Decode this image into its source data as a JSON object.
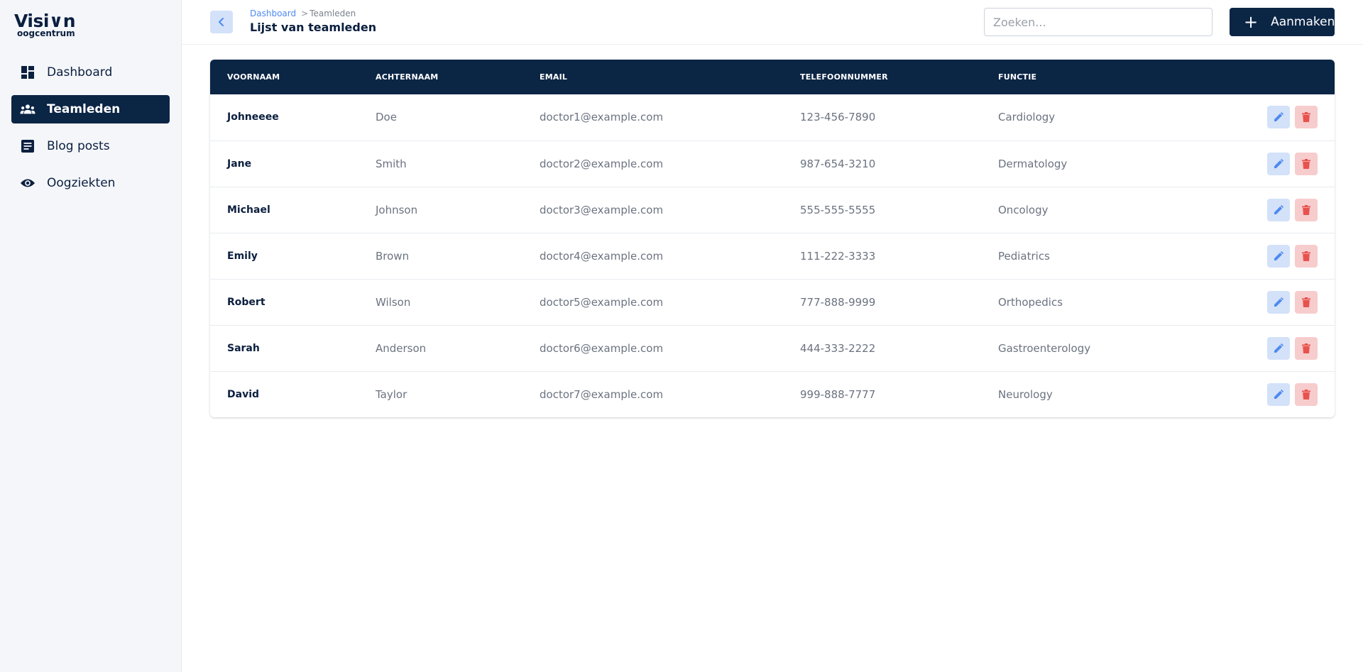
{
  "brand": {
    "name": "Visi∨n",
    "sub": "oogcentrum"
  },
  "nav": [
    {
      "label": "Dashboard",
      "icon": "dashboard-icon",
      "active": false
    },
    {
      "label": "Teamleden",
      "icon": "team-icon",
      "active": true
    },
    {
      "label": "Blog posts",
      "icon": "article-icon",
      "active": false
    },
    {
      "label": "Oogziekten",
      "icon": "eye-icon",
      "active": false
    }
  ],
  "header": {
    "breadcrumb": {
      "parent": "Dashboard",
      "separator": ">",
      "current": "Teamleden"
    },
    "title": "Lijst van teamleden",
    "search_placeholder": "Zoeken...",
    "search_value": "",
    "create_label": "Aanmaken"
  },
  "table": {
    "columns": [
      "VOORNAAM",
      "ACHTERNAAM",
      "EMAIL",
      "TELEFOONNUMMER",
      "FUNCTIE",
      ""
    ],
    "rows": [
      {
        "first": "Johneeee",
        "last": "Doe",
        "email": "doctor1@example.com",
        "phone": "123-456-7890",
        "role": "Cardiology"
      },
      {
        "first": "Jane",
        "last": "Smith",
        "email": "doctor2@example.com",
        "phone": "987-654-3210",
        "role": "Dermatology"
      },
      {
        "first": "Michael",
        "last": "Johnson",
        "email": "doctor3@example.com",
        "phone": "555-555-5555",
        "role": "Oncology"
      },
      {
        "first": "Emily",
        "last": "Brown",
        "email": "doctor4@example.com",
        "phone": "111-222-3333",
        "role": "Pediatrics"
      },
      {
        "first": "Robert",
        "last": "Wilson",
        "email": "doctor5@example.com",
        "phone": "777-888-9999",
        "role": "Orthopedics"
      },
      {
        "first": "Sarah",
        "last": "Anderson",
        "email": "doctor6@example.com",
        "phone": "444-333-2222",
        "role": "Gastroenterology"
      },
      {
        "first": "David",
        "last": "Taylor",
        "email": "doctor7@example.com",
        "phone": "999-888-7777",
        "role": "Neurology"
      }
    ]
  },
  "colors": {
    "primary": "#0b2545",
    "accent": "#4d8af0",
    "edit_bg": "#d3e1f9",
    "delete_bg": "#f7cccd",
    "delete_icon": "#e8524e"
  }
}
